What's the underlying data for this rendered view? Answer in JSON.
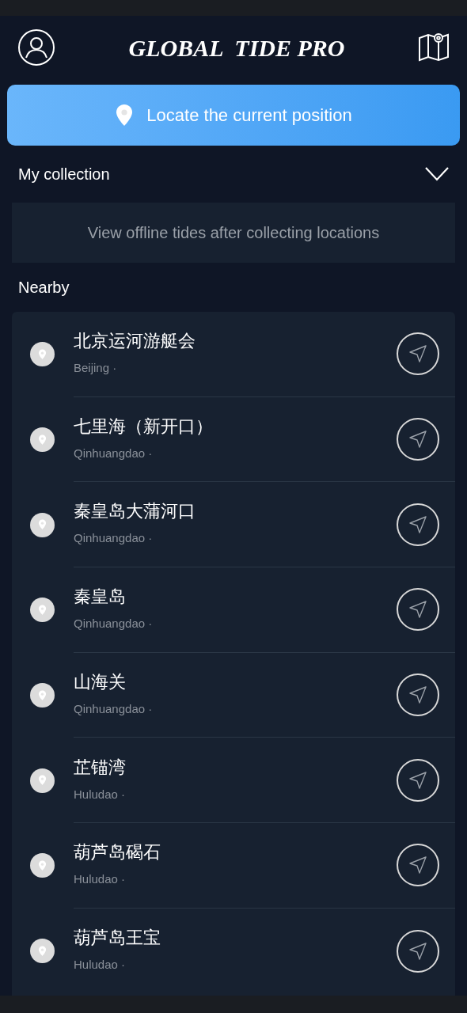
{
  "header": {
    "title": "GLOBAL  TIDE PRO"
  },
  "locate_button": {
    "label": "Locate the current position"
  },
  "collection": {
    "title": "My collection",
    "empty_message": "View offline tides after collecting locations"
  },
  "nearby": {
    "title": "Nearby",
    "items": [
      {
        "name": "北京运河游艇会",
        "region": "Beijing ·"
      },
      {
        "name": "七里海（新开口）",
        "region": "Qinhuangdao ·"
      },
      {
        "name": "秦皇岛大蒲河口",
        "region": "Qinhuangdao ·"
      },
      {
        "name": "秦皇岛",
        "region": "Qinhuangdao ·"
      },
      {
        "name": "山海关",
        "region": "Qinhuangdao ·"
      },
      {
        "name": "芷锚湾",
        "region": "Huludao ·"
      },
      {
        "name": "葫芦岛碣石",
        "region": "Huludao ·"
      },
      {
        "name": "葫芦岛王宝",
        "region": "Huludao ·"
      }
    ]
  }
}
